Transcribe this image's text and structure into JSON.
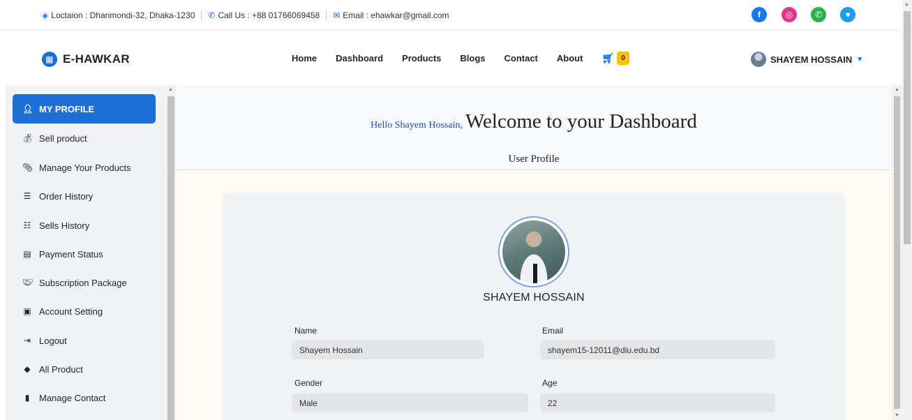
{
  "topbar": {
    "location": "Loctaion : Dhanmondi-32, Dhaka-1230",
    "phone": "Call Us : +88 01766069458",
    "email": "Email : ehawkar@gmail.com",
    "social_icons": [
      "facebook-icon",
      "instagram-icon",
      "whatsapp-icon",
      "twitter-icon"
    ]
  },
  "navbar": {
    "brand": "E-HAWKAR",
    "links": [
      "Home",
      "Dashboard",
      "Products",
      "Blogs",
      "Contact",
      "About"
    ],
    "cart_count": "0",
    "user_name": "SHAYEM HOSSAIN"
  },
  "sidebar": {
    "items": [
      {
        "label": "MY PROFILE",
        "icon": "user-icon"
      },
      {
        "label": "Sell product",
        "icon": "money-bag-icon"
      },
      {
        "label": "Manage Your Products",
        "icon": "paperclip-icon"
      },
      {
        "label": "Order History",
        "icon": "list-check-icon"
      },
      {
        "label": "Sells History",
        "icon": "list-ordered-icon"
      },
      {
        "label": "Payment Status",
        "icon": "invoice-icon"
      },
      {
        "label": "Subscription Package",
        "icon": "handshake-icon"
      },
      {
        "label": "Account Setting",
        "icon": "id-card-icon"
      },
      {
        "label": "Logout",
        "icon": "logout-icon"
      },
      {
        "label": "All Product",
        "icon": "layers-icon"
      },
      {
        "label": "Manage Contact",
        "icon": "contact-book-icon"
      }
    ]
  },
  "main": {
    "hello": "Hello Shayem Hossain,",
    "welcome": "Welcome to your Dashboard",
    "subtitle": "User Profile",
    "profile": {
      "name_display": "SHAYEM HOSSAIN",
      "name_label": "Name",
      "name_value": "Shayem Hossain",
      "email_label": "Email",
      "email_value": "shayem15-12011@diu.edu.bd",
      "gender_label": "Gender",
      "gender_value": "Male",
      "age_label": "Age",
      "age_value": "22"
    }
  },
  "colors": {
    "primary": "#1d6fd6",
    "badge": "#ffc107",
    "hello_text": "#1f4ea8"
  }
}
